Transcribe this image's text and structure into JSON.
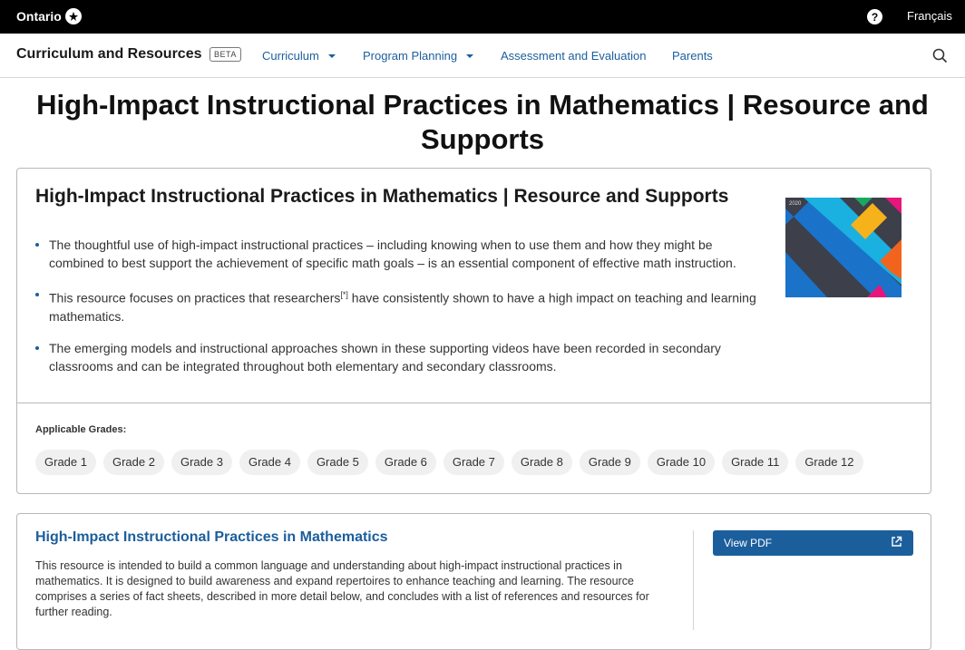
{
  "topbar": {
    "logo_text": "Ontario",
    "language_link": "Français"
  },
  "header": {
    "brand": "Curriculum and Resources",
    "badge": "BETA",
    "nav": [
      {
        "label": "Curriculum",
        "dropdown": true
      },
      {
        "label": "Program Planning",
        "dropdown": true
      },
      {
        "label": "Assessment and Evaluation",
        "dropdown": false
      },
      {
        "label": "Parents",
        "dropdown": false
      }
    ]
  },
  "page": {
    "title": "High-Impact Instructional Practices in Mathematics | Resource and Supports"
  },
  "summary_card": {
    "title": "High-Impact Instructional Practices in Mathematics | Resource and Supports",
    "bullet_1": "The thoughtful use of high-impact instructional practices – including knowing when to use them and how they might be combined to best support the achievement of specific math goals – is an essential component of effective math instruction.",
    "bullet_2_a": "This resource focuses on practices that researchers",
    "bullet_2_ref": "[*]",
    "bullet_2_b": " have consistently shown to have a high impact on teaching and learning mathematics.",
    "bullet_3": "The emerging models and instructional approaches shown in these supporting videos have been recorded in secondary classrooms and can be integrated throughout both elementary and secondary classrooms.",
    "cover_year": "2020",
    "grades_label": "Applicable Grades:",
    "grades": [
      "Grade 1",
      "Grade 2",
      "Grade 3",
      "Grade 4",
      "Grade 5",
      "Grade 6",
      "Grade 7",
      "Grade 8",
      "Grade 9",
      "Grade 10",
      "Grade 11",
      "Grade 12"
    ]
  },
  "resource_card": {
    "title": "High-Impact Instructional Practices in Mathematics",
    "description": "This resource is intended to build a common language and understanding about high-impact instructional practices in mathematics. It is designed to build awareness and expand repertoires to enhance teaching and learning. The resource comprises a series of fact sheets, described in more detail below, and concludes with a list of references and resources for further reading.",
    "button_label": "View PDF"
  },
  "colors": {
    "link": "#1b5e9c",
    "topbar": "#000000",
    "cover_blue": "#1a73c9",
    "cover_cyan": "#1ab0e0",
    "cover_yellow": "#f5b21a",
    "cover_orange": "#f2641e",
    "cover_pink": "#e8157b",
    "cover_green": "#1aa860"
  }
}
